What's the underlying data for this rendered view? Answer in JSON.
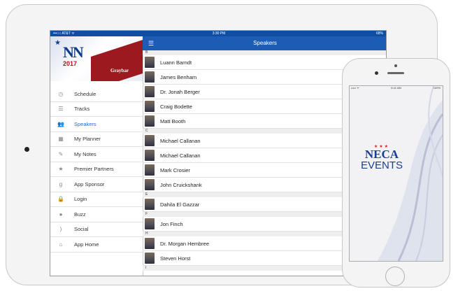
{
  "ipad": {
    "status": {
      "carrier": "•••○○ AT&T ᯤ",
      "time": "3:30 PM",
      "battery": "68%"
    },
    "banner": {
      "logo_text": "NN",
      "year": "2017",
      "sponsor": "Graybar"
    },
    "menu": [
      {
        "label": "Schedule",
        "icon": "clock-icon",
        "glyph": "◷"
      },
      {
        "label": "Tracks",
        "icon": "sliders-icon",
        "glyph": "☰"
      },
      {
        "label": "Speakers",
        "icon": "people-icon",
        "glyph": "👥"
      },
      {
        "label": "My Planner",
        "icon": "calendar-icon",
        "glyph": "▦"
      },
      {
        "label": "My Notes",
        "icon": "pencil-icon",
        "glyph": "✎"
      },
      {
        "label": "Premier Partners",
        "icon": "star-icon",
        "glyph": "★"
      },
      {
        "label": "App Sponsor",
        "icon": "graybar-logo-icon",
        "glyph": "g"
      },
      {
        "label": "Login",
        "icon": "lock-icon",
        "glyph": "🔒"
      },
      {
        "label": "Buzz",
        "icon": "chat-bubble-icon",
        "glyph": "●"
      },
      {
        "label": "Social",
        "icon": "rss-icon",
        "glyph": ")"
      },
      {
        "label": "App Home",
        "icon": "home-icon",
        "glyph": "⌂"
      }
    ],
    "active_menu": "Speakers",
    "navbar": {
      "title": "Speakers"
    },
    "speakers": [
      {
        "letter": "B",
        "names": [
          "Luann Barndt",
          "James Benham",
          "Dr. Jonah Berger",
          "Craig Bodette",
          "Matt Booth"
        ]
      },
      {
        "letter": "C",
        "names": [
          "Michael Callanan",
          "Michael Callanan",
          "Mark Crosier",
          "John  Cruickshank"
        ]
      },
      {
        "letter": "E",
        "names": [
          "Dahila El Gazzar"
        ]
      },
      {
        "letter": "F",
        "names": [
          "Jon  Finch"
        ]
      },
      {
        "letter": "H",
        "names": [
          "Dr. Morgan Hembree",
          "Steven Horst"
        ]
      },
      {
        "letter": "I",
        "names": []
      }
    ]
  },
  "iphone": {
    "status": {
      "carrier": "••••• ᯤ",
      "time": "9:41 AM",
      "battery": "100%"
    },
    "splash": {
      "stars": "★★★",
      "word1": "NECA",
      "word2": "EVENTS"
    }
  },
  "colors": {
    "navbar": "#1d5cb4",
    "accent": "#2a6bd6",
    "banner_red": "#9c1a1f",
    "neca_blue": "#1a3f8f"
  }
}
